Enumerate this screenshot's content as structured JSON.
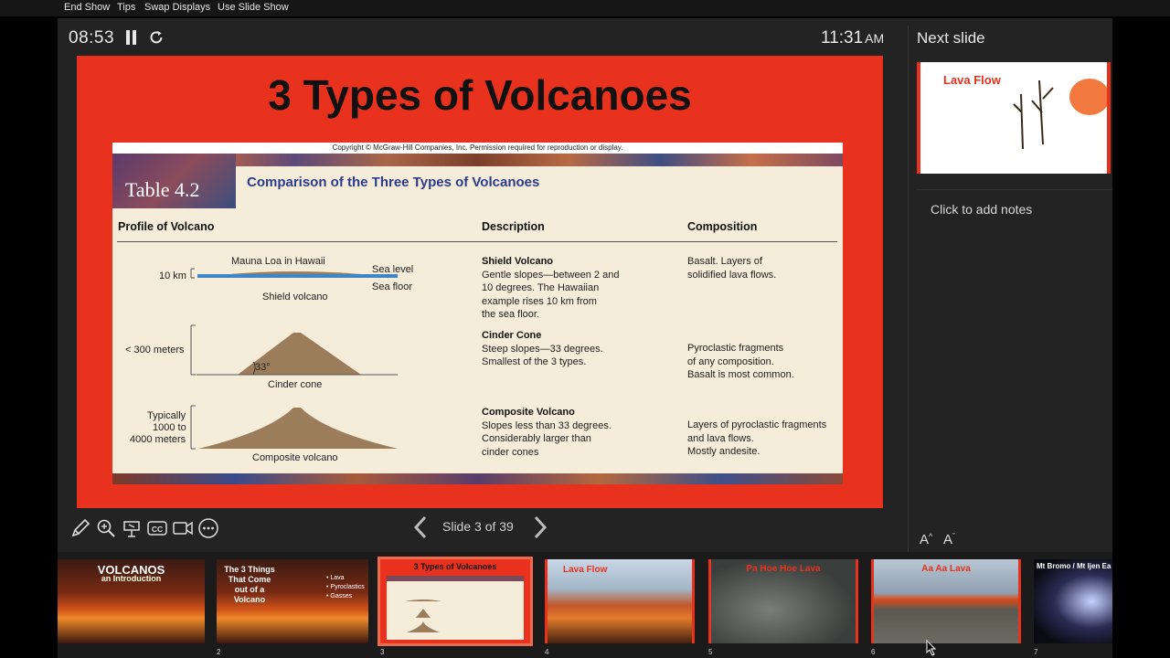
{
  "menubar": {
    "items": [
      "End Show",
      "Tips",
      "Swap Displays",
      "Use Slide Show"
    ]
  },
  "presenter": {
    "timer": "08:53",
    "clock_time": "11:31",
    "clock_ampm": "AM"
  },
  "slide": {
    "title": "3 Types of Volcanoes",
    "image": {
      "copyright": "Copyright © McGraw-Hill Companies, Inc. Permission required for reproduction or display.",
      "table_label": "Table 4.2",
      "heading": "Comparison of the Three Types of Volcanoes",
      "columns": [
        "Profile of Volcano",
        "Description",
        "Composition"
      ],
      "shield": {
        "top_label": "Mauna Loa in Hawaii",
        "height": "10 km",
        "sea_level": "Sea level",
        "sea_floor": "Sea floor",
        "caption": "Shield volcano"
      },
      "cinder": {
        "height": "< 300 meters",
        "angle": "33°",
        "caption": "Cinder cone"
      },
      "composite": {
        "height_line1": "Typically",
        "height_line2": "1000 to",
        "height_line3": "4000 meters",
        "caption": "Composite volcano"
      },
      "rows": [
        {
          "name": "Shield Volcano",
          "desc": [
            "Gentle slopes—between 2 and",
            "10 degrees. The Hawaiian",
            "example rises 10 km from",
            "the sea floor."
          ],
          "comp": [
            "Basalt. Layers of",
            "solidified lava flows."
          ]
        },
        {
          "name": "Cinder Cone",
          "desc": [
            "Steep slopes—33 degrees.",
            "Smallest of the 3 types."
          ],
          "comp": [
            "Pyroclastic fragments",
            "of any composition.",
            "Basalt is most common."
          ]
        },
        {
          "name": "Composite Volcano",
          "desc": [
            "Slopes less than 33 degrees.",
            "Considerably larger than",
            "cinder cones"
          ],
          "comp": [
            "Layers of pyroclastic fragments",
            "and lava flows.",
            "Mostly andesite."
          ]
        }
      ]
    }
  },
  "nav": {
    "counter": "Slide 3 of 39"
  },
  "next_slide": {
    "label": "Next slide",
    "title": "Lava Flow"
  },
  "notes": {
    "placeholder": "Click to add notes"
  },
  "font_buttons": {
    "increase": "A",
    "decrease": "A"
  },
  "filmstrip": [
    {
      "number": "",
      "title": "VOLCANOS",
      "subtitle": "an Introduction"
    },
    {
      "number": "2",
      "title": "The 3 Things That Come out of a Volcano",
      "bullets": [
        "• Lava",
        "• Pyroclastics",
        "• Gasses"
      ]
    },
    {
      "number": "3",
      "title": "3 Types of Volcanoes"
    },
    {
      "number": "4",
      "title": "Lava Flow"
    },
    {
      "number": "5",
      "title": "Pa Hoe Hoe Lava"
    },
    {
      "number": "6",
      "title": "Aa Aa Lava"
    },
    {
      "number": "7",
      "title": "Mt Bromo / Mt Ijen Ea"
    }
  ]
}
